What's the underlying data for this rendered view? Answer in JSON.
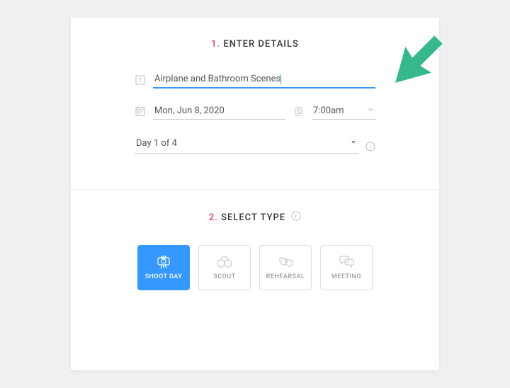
{
  "section1": {
    "num": "1.",
    "title": "ENTER DETAILS"
  },
  "section2": {
    "num": "2.",
    "title": "SELECT TYPE"
  },
  "details": {
    "title_value": "Airplane and Bathroom Scenes",
    "date_value": "Mon, Jun 8, 2020",
    "at_label": "@",
    "time_value": "7:00am",
    "day_value": "Day 1 of 4"
  },
  "types": [
    {
      "label": "SHOOT DAY",
      "active": true
    },
    {
      "label": "SCOUT",
      "active": false
    },
    {
      "label": "REHEARSAL",
      "active": false
    },
    {
      "label": "MEETING",
      "active": false
    }
  ]
}
